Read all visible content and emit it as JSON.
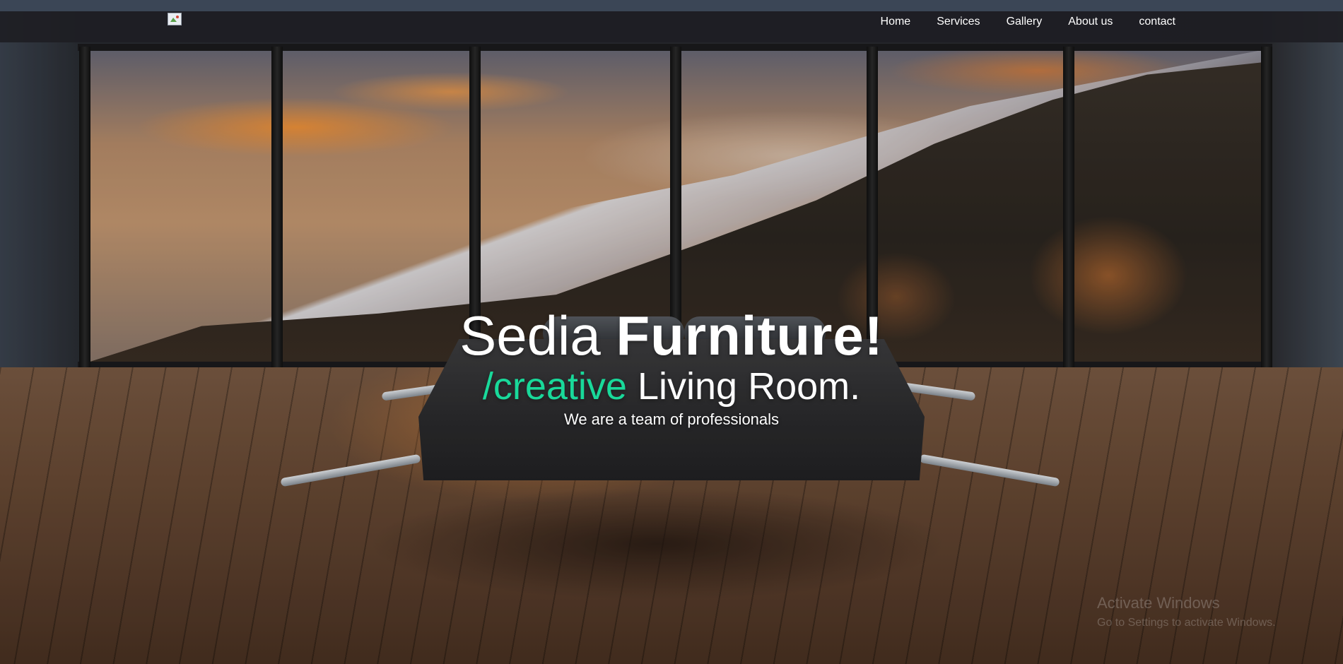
{
  "nav": {
    "logo_alt": "logo",
    "links": [
      {
        "label": "Home"
      },
      {
        "label": "Services"
      },
      {
        "label": "Gallery"
      },
      {
        "label": "About us"
      },
      {
        "label": "contact"
      }
    ]
  },
  "hero": {
    "headline_regular": "Sedia",
    "headline_bold": "Furniture!",
    "subhead_accent": "/creative",
    "subhead_rest": "Living Room.",
    "tagline": "We are a team of professionals",
    "accent_color": "#19d99a"
  },
  "watermark": {
    "title": "Activate Windows",
    "subtitle": "Go to Settings to activate Windows."
  }
}
